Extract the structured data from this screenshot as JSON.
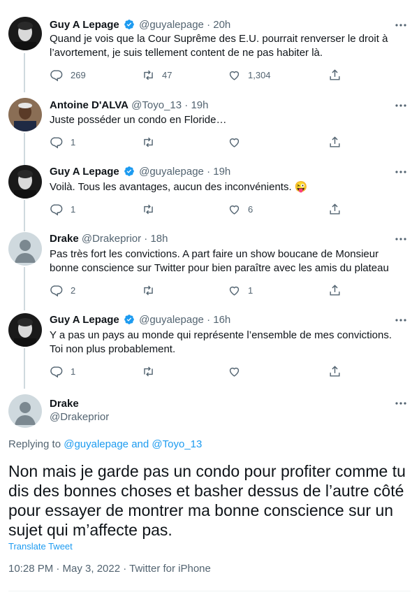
{
  "colors": {
    "text": "#0f1419",
    "secondary": "#536471",
    "link": "#1d9bf0",
    "verified": "#1d9bf0",
    "thread_line": "#cfd9de"
  },
  "tweets": [
    {
      "name": "Guy A Lepage",
      "verified": true,
      "handle": "@guyalepage",
      "time": "20h",
      "text": "Quand je vois que la Cour Suprême des E.U. pourrait renverser le droit à l’avortement, je suis tellement content de ne pas habiter là.",
      "replies": "269",
      "retweets": "47",
      "likes": "1,304"
    },
    {
      "name": "Antoine D'ALVA",
      "verified": false,
      "handle": "@Toyo_13",
      "time": "19h",
      "text": "Juste posséder un condo en Floride…",
      "replies": "1",
      "retweets": "",
      "likes": ""
    },
    {
      "name": "Guy A Lepage",
      "verified": true,
      "handle": "@guyalepage",
      "time": "19h",
      "text": "Voilà. Tous les avantages, aucun des inconvénients. 😜",
      "replies": "1",
      "retweets": "",
      "likes": "6"
    },
    {
      "name": "Drake",
      "verified": false,
      "handle": "@Drakeprior",
      "time": "18h",
      "text": "Pas très fort les convictions. A part faire un show boucane de Monsieur bonne conscience sur Twitter pour bien paraître avec les amis du plateau",
      "replies": "2",
      "retweets": "",
      "likes": "1"
    },
    {
      "name": "Guy A Lepage",
      "verified": true,
      "handle": "@guyalepage",
      "time": "16h",
      "text": "Y a pas un pays au monde qui représente l’ensemble de mes convictions. Toi non plus probablement.",
      "replies": "1",
      "retweets": "",
      "likes": ""
    }
  ],
  "main": {
    "name": "Drake",
    "handle": "@Drakeprior",
    "replying_prefix": "Replying to",
    "replying_to_1": "@guyalepage",
    "replying_and": "and",
    "replying_to_2": "@Toyo_13",
    "text": "Non mais je garde pas un condo pour profiter comme tu dis des bonnes choses et  basher dessus  de l’autre côté pour essayer de montrer ma bonne conscience sur un sujet qui m’affecte pas.",
    "translate": "Translate Tweet",
    "meta": "10:28 PM · May 3, 2022 · Twitter for iPhone"
  },
  "separator": "·"
}
